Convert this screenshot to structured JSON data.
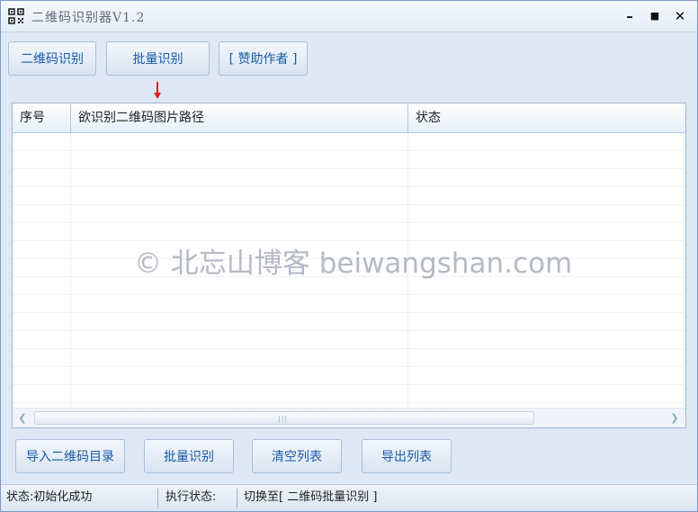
{
  "window": {
    "title": "二维码识别器V1.2",
    "icon": "qr-code-icon",
    "minimize": "–",
    "maximize": "■",
    "close": "✕"
  },
  "toolbar": {
    "recognize": "二维码识别",
    "batch": "批量识别",
    "sponsor": "[ 赞助作者 ]"
  },
  "table": {
    "columns": [
      "序号",
      "欲识别二维码图片路径",
      "状态"
    ],
    "rows": []
  },
  "watermark": "© 北忘山博客 beiwangshan.com",
  "bottom_buttons": {
    "import_dir": "导入二维码目录",
    "batch": "批量识别",
    "clear": "清空列表",
    "export": "导出列表"
  },
  "statusbar": {
    "status": "状态:初始化成功",
    "exec_label": "执行状态:",
    "exec_value": "切换至[ 二维码批量识别 ]"
  },
  "colors": {
    "accent_text": "#1a5aa8",
    "arrow": "#e02020",
    "background": "#dde8f4"
  }
}
